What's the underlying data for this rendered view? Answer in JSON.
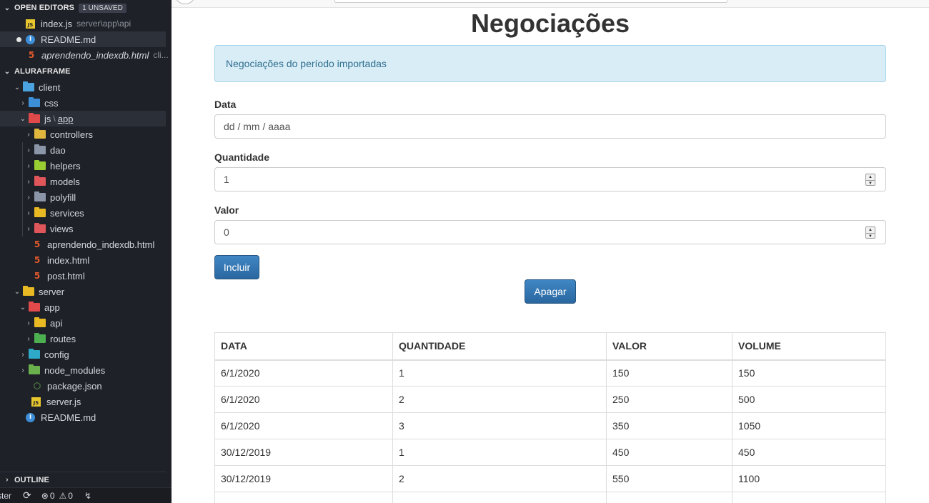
{
  "explorer": {
    "open_editors": {
      "title": "OPEN EDITORS",
      "badge": "1 UNSAVED",
      "items": [
        {
          "name": "index.js",
          "path": "server\\app\\api"
        },
        {
          "name": "README.md",
          "path": ""
        },
        {
          "name": "aprendendo_indexdb.html",
          "path": "cli..."
        }
      ]
    },
    "project": {
      "title": "ALURAFRAME",
      "client": "client",
      "css": "css",
      "js": "js",
      "sep": "\\",
      "app": "app",
      "controllers": "controllers",
      "dao": "dao",
      "helpers": "helpers",
      "models": "models",
      "polyfill": "polyfill",
      "services": "services",
      "views": "views",
      "file_aprendendo": "aprendendo_indexdb.html",
      "file_index": "index.html",
      "file_post": "post.html",
      "server": "server",
      "server_app": "app",
      "api": "api",
      "routes": "routes",
      "config": "config",
      "node_modules": "node_modules",
      "package_json": "package.json",
      "server_js": "server.js",
      "readme": "README.md"
    },
    "outline": "OUTLINE"
  },
  "statusbar": {
    "branch": "ster",
    "errors": "0",
    "warnings": "0"
  },
  "page": {
    "title": "Negociações",
    "alert": "Negociações do período importadas",
    "form": {
      "data_label": "Data",
      "data_placeholder": "dd / mm / aaaa",
      "quantidade_label": "Quantidade",
      "quantidade_value": "1",
      "valor_label": "Valor",
      "valor_value": "0",
      "incluir_label": "Incluir",
      "apagar_label": "Apagar"
    },
    "table": {
      "headers": [
        "DATA",
        "QUANTIDADE",
        "VALOR",
        "VOLUME"
      ],
      "rows": [
        [
          "6/1/2020",
          "1",
          "150",
          "150"
        ],
        [
          "6/1/2020",
          "2",
          "250",
          "500"
        ],
        [
          "6/1/2020",
          "3",
          "350",
          "1050"
        ],
        [
          "30/12/2019",
          "1",
          "450",
          "450"
        ],
        [
          "30/12/2019",
          "2",
          "550",
          "1100"
        ]
      ]
    }
  },
  "colors": {
    "sidebar_bg": "#1e2128",
    "primary_button": "#337ab7",
    "alert_bg": "#d9edf7",
    "alert_text": "#31708f"
  }
}
